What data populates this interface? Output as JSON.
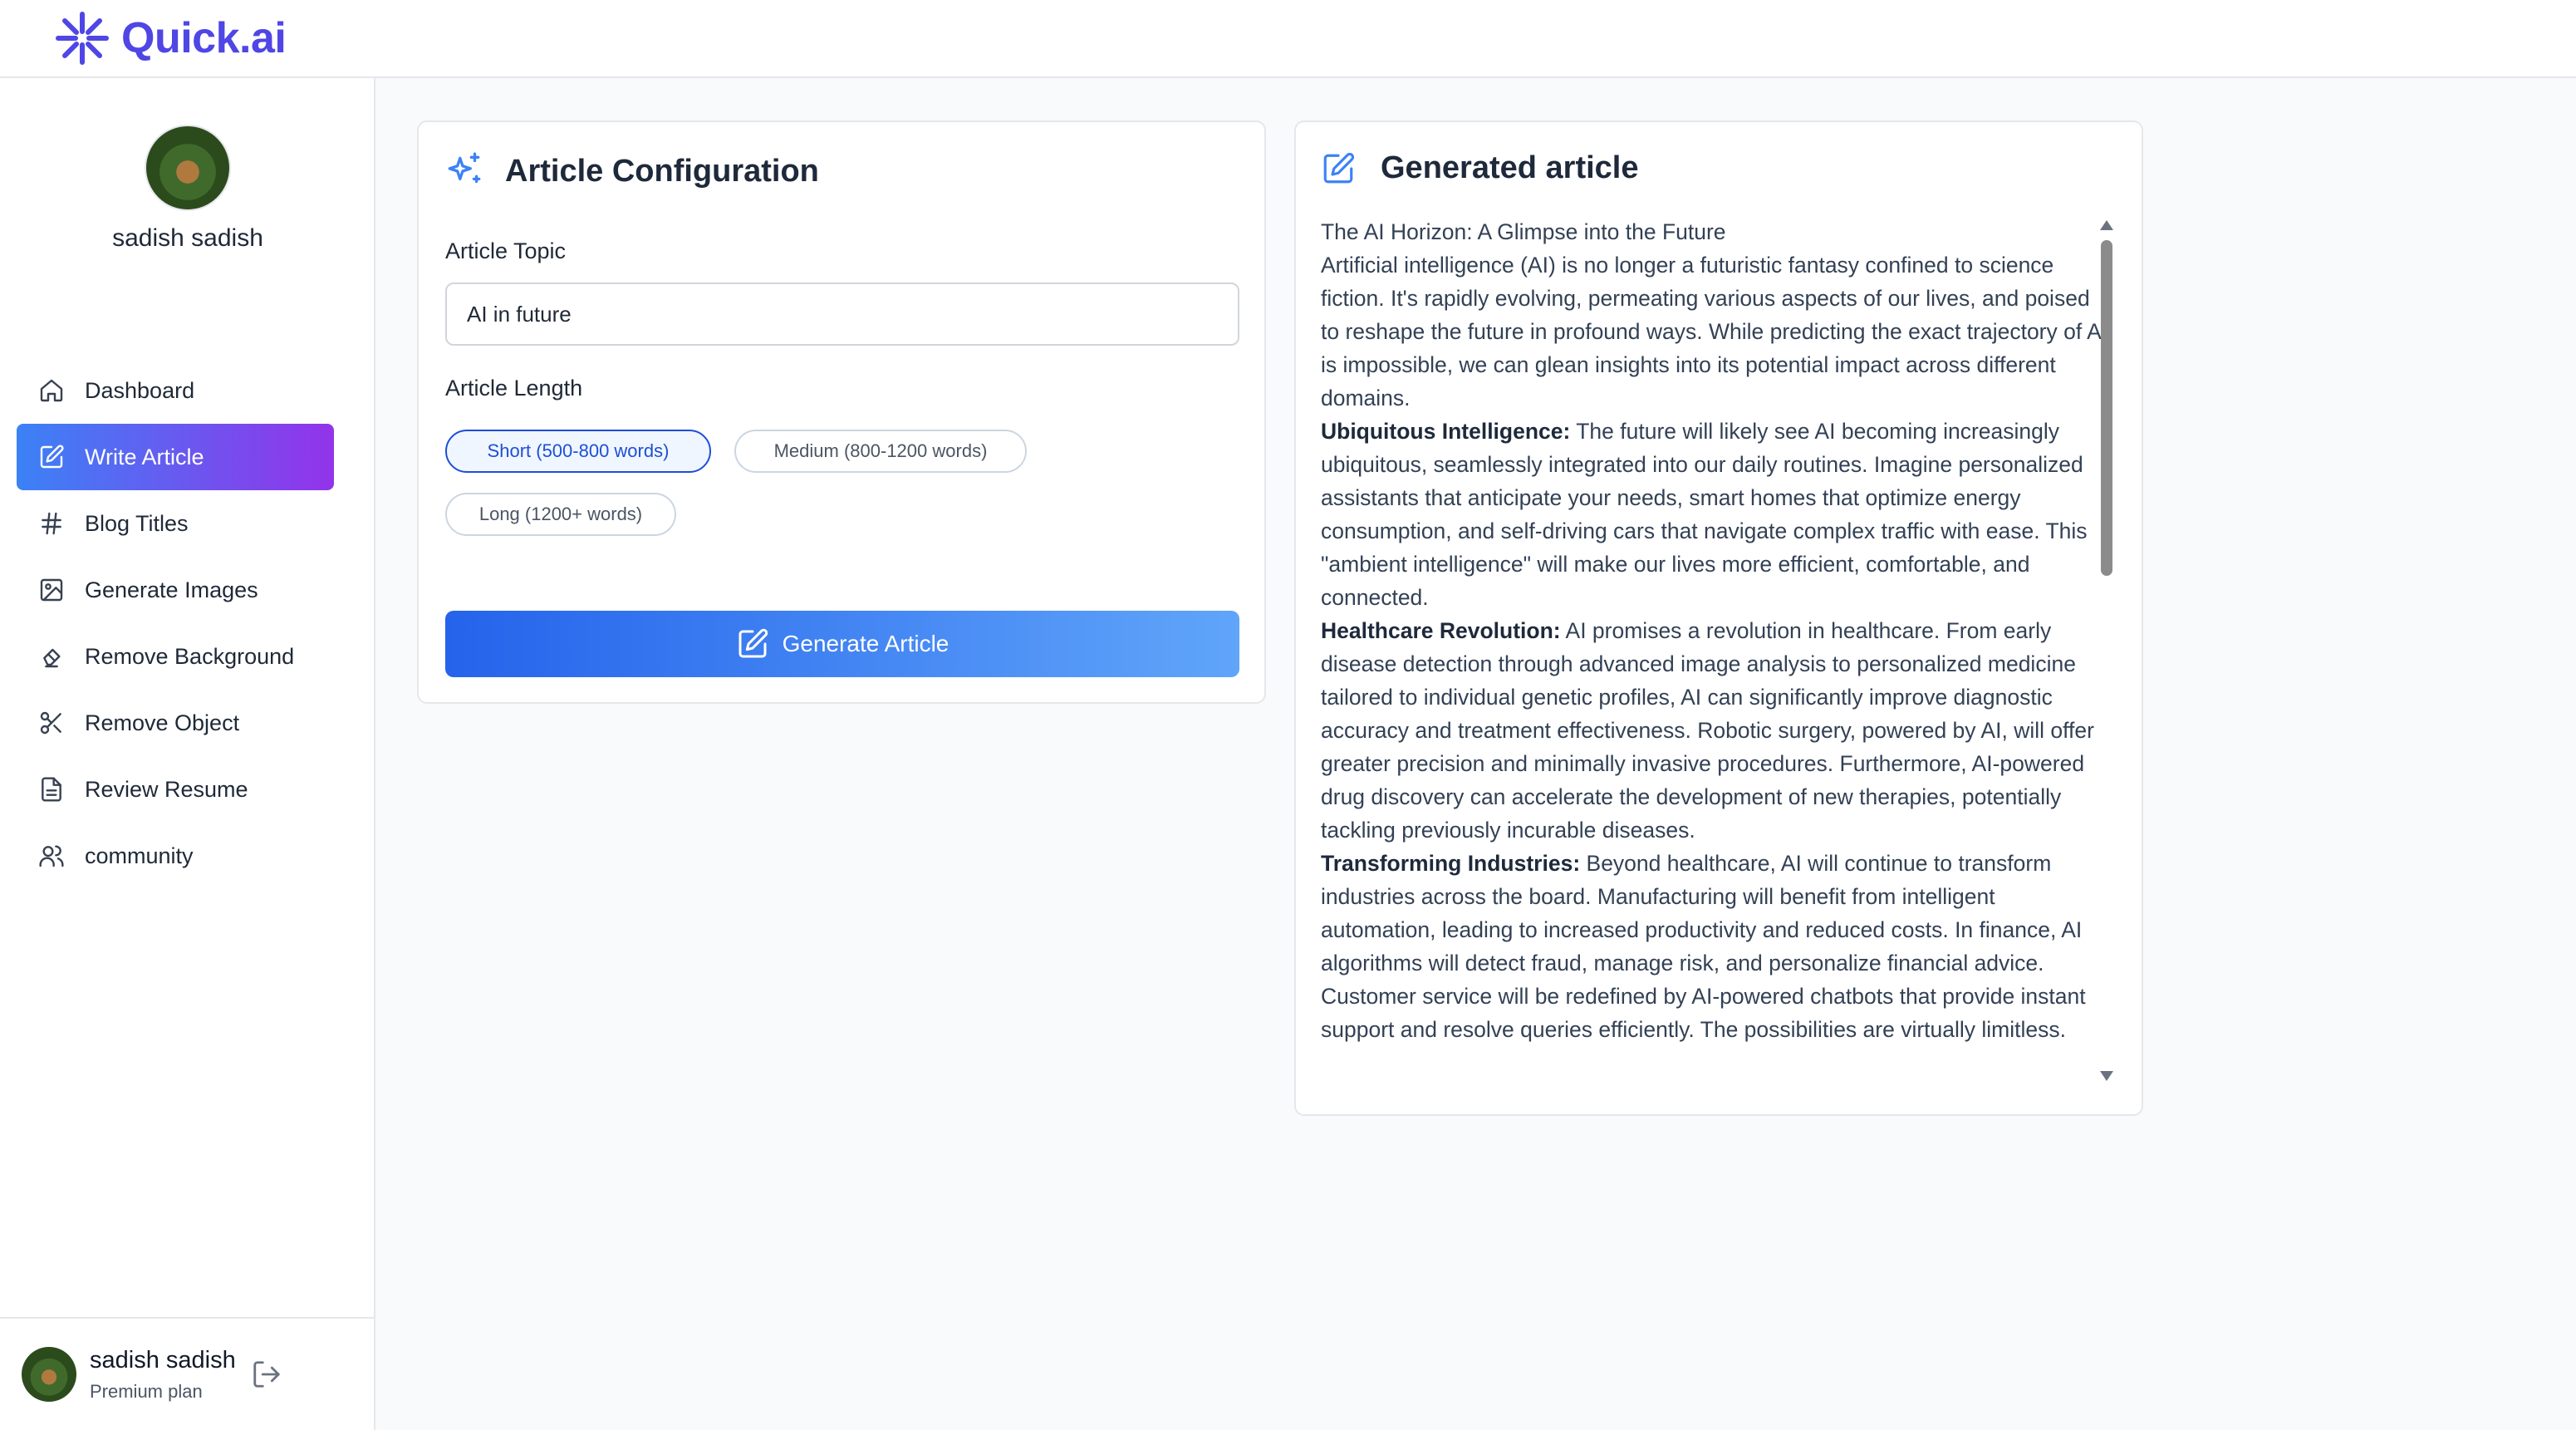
{
  "brand": {
    "name": "Quick.ai",
    "color": "#4f46e5"
  },
  "user": {
    "name": "sadish sadish",
    "plan": "Premium plan"
  },
  "sidebar": {
    "items": [
      {
        "label": "Dashboard",
        "icon": "home-icon",
        "active": false
      },
      {
        "label": "Write Article",
        "icon": "edit-icon",
        "active": true
      },
      {
        "label": "Blog Titles",
        "icon": "hash-icon",
        "active": false
      },
      {
        "label": "Generate Images",
        "icon": "image-icon",
        "active": false
      },
      {
        "label": "Remove Background",
        "icon": "eraser-icon",
        "active": false
      },
      {
        "label": "Remove Object",
        "icon": "scissors-icon",
        "active": false
      },
      {
        "label": "Review Resume",
        "icon": "file-text-icon",
        "active": false
      },
      {
        "label": "community",
        "icon": "users-icon",
        "active": false
      }
    ]
  },
  "config": {
    "title": "Article Configuration",
    "topic_label": "Article Topic",
    "topic_value": "AI in future",
    "length_label": "Article Length",
    "lengths": [
      {
        "label": "Short (500-800 words)",
        "selected": true
      },
      {
        "label": "Medium (800-1200 words)",
        "selected": false
      },
      {
        "label": "Long (1200+ words)",
        "selected": false
      }
    ],
    "generate_label": "Generate Article"
  },
  "article": {
    "title": "Generated article",
    "heading": "The AI Horizon: A Glimpse into the Future",
    "intro": "Artificial intelligence (AI) is no longer a futuristic fantasy confined to science fiction. It's rapidly evolving, permeating various aspects of our lives, and poised to reshape the future in profound ways. While predicting the exact trajectory of AI is impossible, we can glean insights into its potential impact across different domains.",
    "sections": [
      {
        "bold": "Ubiquitous Intelligence:",
        "text": " The future will likely see AI becoming increasingly ubiquitous, seamlessly integrated into our daily routines. Imagine personalized assistants that anticipate your needs, smart homes that optimize energy consumption, and self-driving cars that navigate complex traffic with ease. This \"ambient intelligence\" will make our lives more efficient, comfortable, and connected."
      },
      {
        "bold": "Healthcare Revolution:",
        "text": " AI promises a revolution in healthcare. From early disease detection through advanced image analysis to personalized medicine tailored to individual genetic profiles, AI can significantly improve diagnostic accuracy and treatment effectiveness. Robotic surgery, powered by AI, will offer greater precision and minimally invasive procedures. Furthermore, AI-powered drug discovery can accelerate the development of new therapies, potentially tackling previously incurable diseases."
      },
      {
        "bold": "Transforming Industries:",
        "text": " Beyond healthcare, AI will continue to transform industries across the board. Manufacturing will benefit from intelligent automation, leading to increased productivity and reduced costs. In finance, AI algorithms will detect fraud, manage risk, and personalize financial advice. Customer service will be redefined by AI-powered chatbots that provide instant support and resolve queries efficiently. The possibilities are virtually limitless."
      }
    ]
  }
}
